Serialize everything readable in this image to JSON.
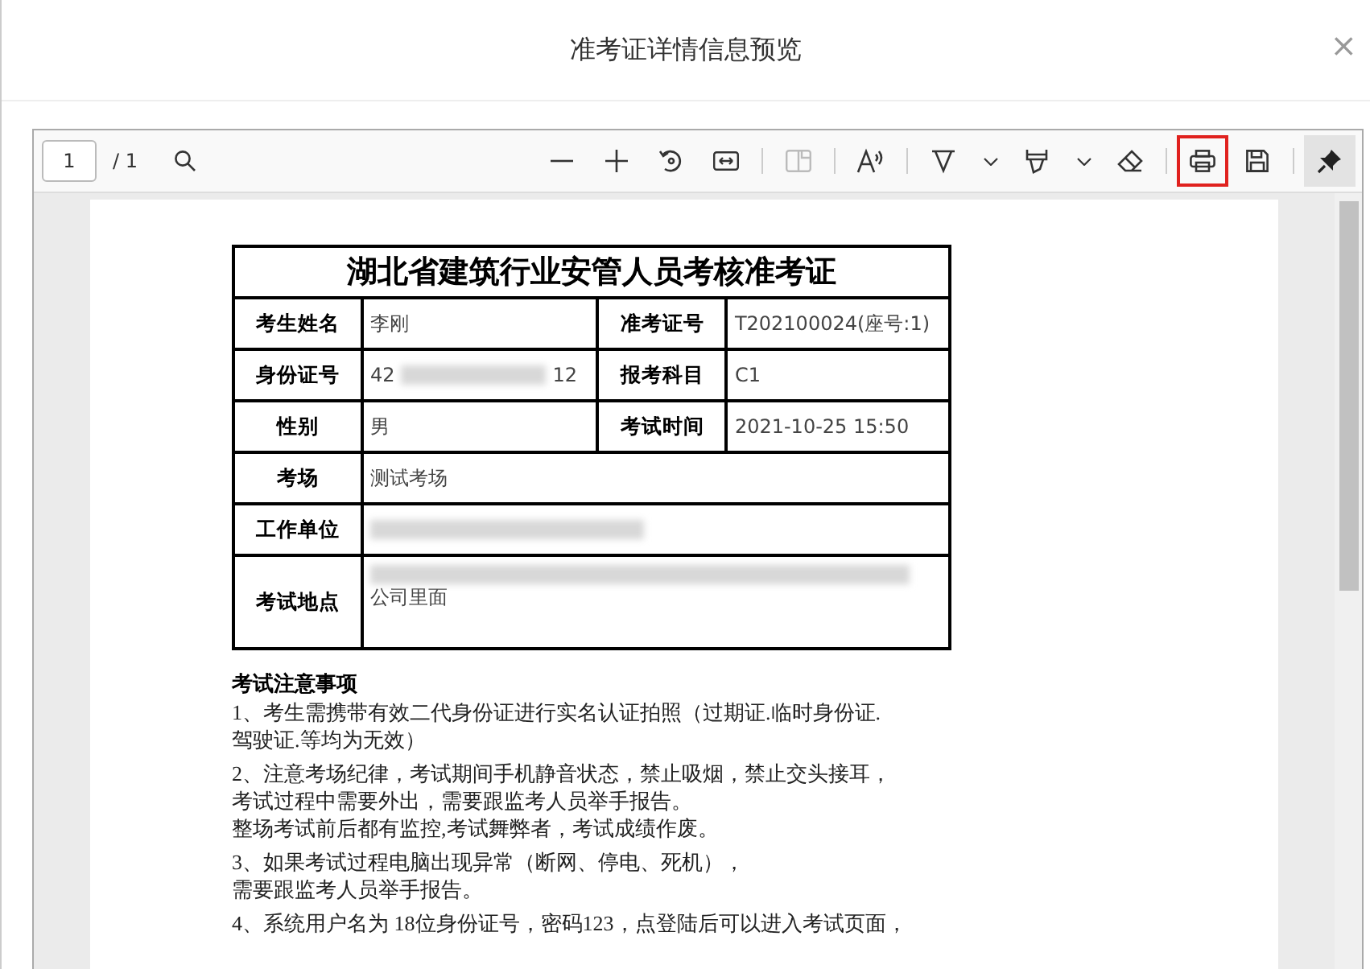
{
  "dialog": {
    "title": "准考证详情信息预览",
    "close": "×"
  },
  "toolbar": {
    "page": "1",
    "page_count": "/ 1",
    "tools": [
      {
        "kind": "search"
      },
      {
        "kind": "gap"
      },
      {
        "kind": "minus"
      },
      {
        "kind": "plus"
      },
      {
        "kind": "rotate"
      },
      {
        "kind": "fit"
      },
      {
        "kind": "sep"
      },
      {
        "kind": "pageview",
        "disabled": true
      },
      {
        "kind": "sep"
      },
      {
        "kind": "read"
      },
      {
        "kind": "sep"
      },
      {
        "kind": "highlight"
      },
      {
        "kind": "caret"
      },
      {
        "kind": "draw"
      },
      {
        "kind": "caret"
      },
      {
        "kind": "eraser"
      },
      {
        "kind": "sep"
      },
      {
        "kind": "print",
        "highlighted": true
      },
      {
        "kind": "save"
      },
      {
        "kind": "sep"
      },
      {
        "kind": "pin",
        "selected": true
      }
    ]
  },
  "document": {
    "title": "湖北省建筑行业安管人员考核准考证",
    "rows": [
      {
        "cells": [
          {
            "label": "考生姓名",
            "value": "李刚"
          },
          {
            "label": "准考证号",
            "value": "T202100024(座号:1)"
          }
        ]
      },
      {
        "cells": [
          {
            "label": "身份证号",
            "value": "42",
            "value_end": "12",
            "redacted": true
          },
          {
            "label": "报考科目",
            "value": "C1"
          }
        ]
      },
      {
        "cells": [
          {
            "label": "性别",
            "value": "男"
          },
          {
            "label": "考试时间",
            "value": "2021-10-25 15:50"
          }
        ]
      },
      {
        "cells": [
          {
            "label": "考场",
            "value": "测试考场"
          }
        ]
      },
      {
        "cells": [
          {
            "label": "工作单位",
            "redacted": true
          }
        ]
      },
      {
        "cells": [
          {
            "label": "考试地点",
            "value": "公司里面",
            "redacted": true
          }
        ]
      }
    ],
    "notes_title": "考试注意事项",
    "notes": [
      [
        "1、考生需携带有效二代身份证进行实名认证拍照（过期证.临时身份证.",
        "驾驶证.等均为无效）"
      ],
      [
        "2、注意考场纪律，考试期间手机静音状态，禁止吸烟，禁止交头接耳，",
        "考试过程中需要外出，需要跟监考人员举手报告。",
        "整场考试前后都有监控,考试舞弊者，考试成绩作废。"
      ],
      [
        "3、如果考试过程电脑出现异常（断网、停电、死机），",
        "需要跟监考人员举手报告。"
      ],
      [
        "4、系统用户名为 18位身份证号，密码123，点登陆后可以进入考试页面，"
      ]
    ]
  }
}
